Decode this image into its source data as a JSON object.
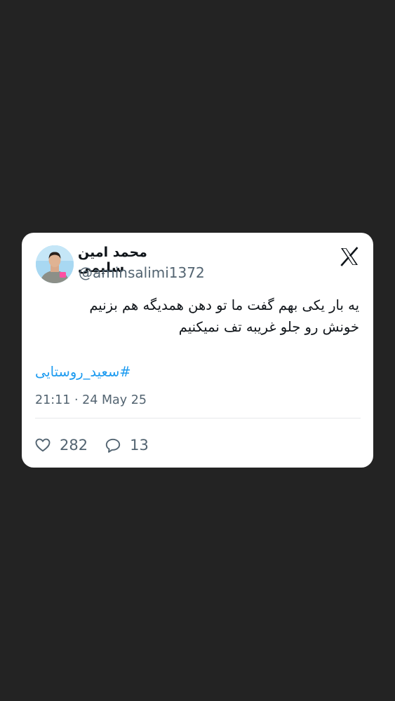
{
  "tweet": {
    "display_name": "محمد امین سلیمی",
    "handle": "@aminsalimi1372",
    "text_lines": [
      "یه بار یکی بهم گفت ما تو دهن همدیگه هم بزنیم",
      "خونش رو جلو غریبه تف نمیکنیم"
    ],
    "hashtag": "#سعید_روستایی",
    "timestamp": "21:11 · 24 May 25",
    "likes": "282",
    "replies": "13"
  },
  "icons": {
    "platform": "x-logo-icon",
    "like": "heart-icon",
    "reply": "speech-bubble-icon"
  },
  "colors": {
    "background": "#232323",
    "card": "#ffffff",
    "text": "#0f1419",
    "secondary": "#536471",
    "link": "#1d9bf0"
  }
}
